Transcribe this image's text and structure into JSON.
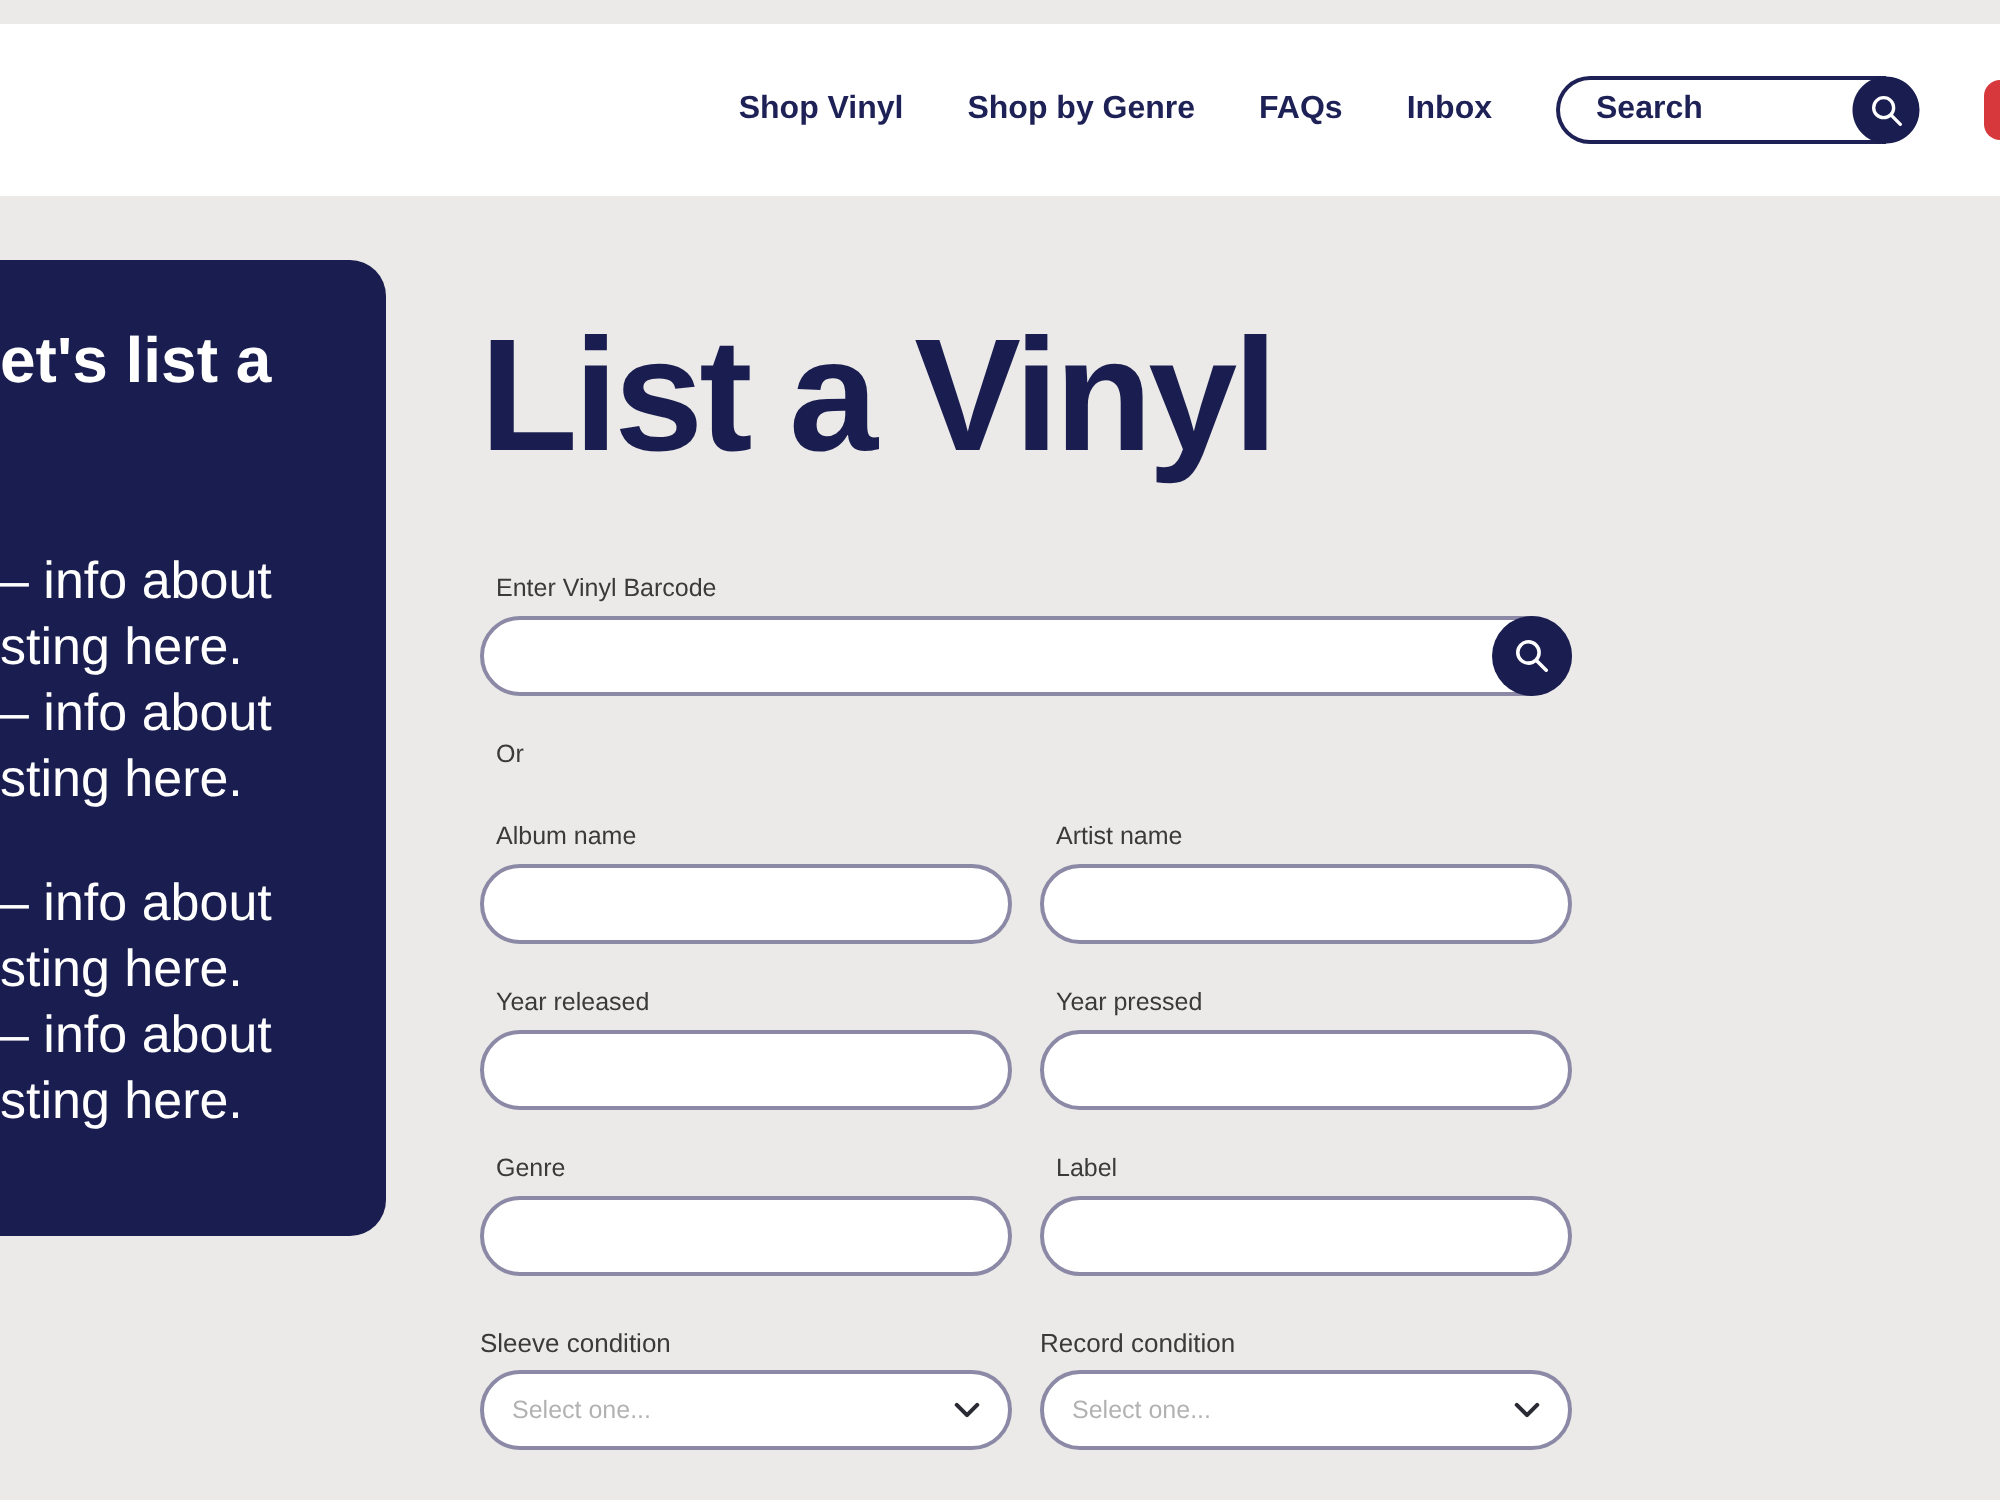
{
  "header": {
    "nav": [
      "Shop Vinyl",
      "Shop by Genre",
      "FAQs",
      "Inbox"
    ],
    "search": {
      "placeholder": "Search"
    }
  },
  "side_panel": {
    "heading": "et's list a",
    "paragraphs": [
      [
        "– info about",
        "sting here.",
        "– info about",
        "sting here."
      ],
      [
        "– info about",
        "sting here.",
        "– info about",
        "sting here."
      ]
    ]
  },
  "form": {
    "title": "List a Vinyl",
    "barcode": {
      "label": "Enter Vinyl Barcode"
    },
    "separator": "Or",
    "fields": [
      {
        "kind": "text",
        "label": "Album name"
      },
      {
        "kind": "text",
        "label": "Artist name"
      },
      {
        "kind": "text",
        "label": "Year released"
      },
      {
        "kind": "text",
        "label": "Year pressed"
      },
      {
        "kind": "text",
        "label": "Genre"
      },
      {
        "kind": "text",
        "label": "Label"
      },
      {
        "kind": "select",
        "label": "Sleeve condition",
        "placeholder": "Select one..."
      },
      {
        "kind": "select",
        "label": "Record condition",
        "placeholder": "Select one..."
      }
    ]
  }
}
